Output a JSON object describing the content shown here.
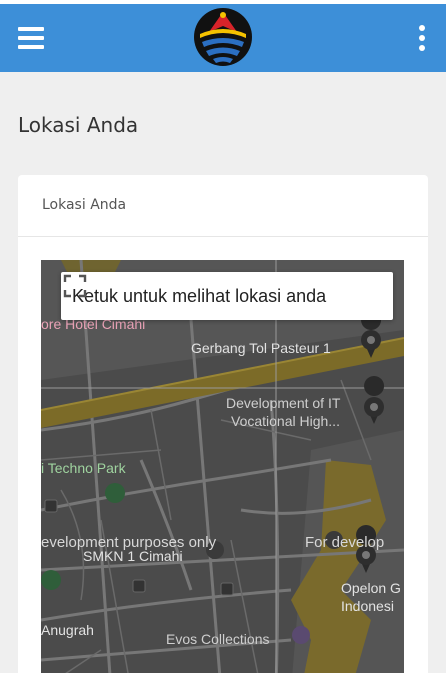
{
  "header": {
    "menu_icon": "hamburger-menu-icon",
    "more_icon": "more-vertical-icon",
    "logo": "institution-logo",
    "bar_color": "#3d8fd8"
  },
  "page": {
    "title": "Lokasi Anda"
  },
  "card": {
    "title": "Lokasi Anda"
  },
  "map": {
    "overlay_text": "Ketuk untuk melihat lokasi anda",
    "fullscreen_icon": "fullscreen-icon",
    "labels": {
      "hotel": "ore Hotel Cimahi",
      "toll_gate": "Gerbang Tol Pasteur 1",
      "dev_it_1": "Development of IT",
      "dev_it_2": "Vocational High...",
      "techno_park": "i Techno Park",
      "watermark_left": "evelopment purposes only",
      "watermark_right": "For develop",
      "smkn": "SMKN 1 Cimahi",
      "opelon_1": "Opelon G",
      "opelon_2": "Indonesi",
      "anugrah": "Anugrah",
      "evos": "Evos Collections"
    }
  }
}
